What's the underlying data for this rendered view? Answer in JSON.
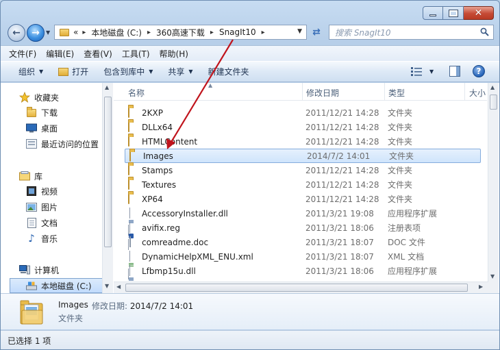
{
  "address": {
    "overflow": "«",
    "crumbs": [
      "本地磁盘 (C:)",
      "360高速下载",
      "SnagIt10"
    ]
  },
  "search": {
    "placeholder": "搜索 SnagIt10"
  },
  "menu": [
    "文件(F)",
    "编辑(E)",
    "查看(V)",
    "工具(T)",
    "帮助(H)"
  ],
  "commands": {
    "organize": "组织",
    "open": "打开",
    "include_library": "包含到库中",
    "share": "共享",
    "new_folder": "新建文件夹"
  },
  "nav": {
    "favorites": "收藏夹",
    "downloads": "下载",
    "desktop": "桌面",
    "recent": "最近访问的位置",
    "libraries": "库",
    "videos": "视频",
    "pictures": "图片",
    "documents": "文档",
    "music": "音乐",
    "computer": "计算机",
    "local_disk": "本地磁盘 (C:)"
  },
  "columns": {
    "name": "名称",
    "date": "修改日期",
    "type": "类型",
    "size": "大小"
  },
  "files": [
    {
      "name": "2KXP",
      "date": "2011/12/21 14:28",
      "type": "文件夹",
      "icon": "folder"
    },
    {
      "name": "DLLx64",
      "date": "2011/12/21 14:28",
      "type": "文件夹",
      "icon": "folder"
    },
    {
      "name": "HTMLContent",
      "date": "2011/12/21 14:28",
      "type": "文件夹",
      "icon": "folder"
    },
    {
      "name": "Images",
      "date": "2014/7/2 14:01",
      "type": "文件夹",
      "icon": "folder",
      "selected": true
    },
    {
      "name": "Stamps",
      "date": "2011/12/21 14:28",
      "type": "文件夹",
      "icon": "folder"
    },
    {
      "name": "Textures",
      "date": "2011/12/21 14:28",
      "type": "文件夹",
      "icon": "folder"
    },
    {
      "name": "XP64",
      "date": "2011/12/21 14:28",
      "type": "文件夹",
      "icon": "folder"
    },
    {
      "name": "AccessoryInstaller.dll",
      "date": "2011/3/21 19:08",
      "type": "应用程序扩展",
      "icon": "dll"
    },
    {
      "name": "avifix.reg",
      "date": "2011/3/21 18:06",
      "type": "注册表项",
      "icon": "reg"
    },
    {
      "name": "comreadme.doc",
      "date": "2011/3/21 18:07",
      "type": "DOC 文件",
      "icon": "doc"
    },
    {
      "name": "DynamicHelpXML_ENU.xml",
      "date": "2011/3/21 18:07",
      "type": "XML 文档",
      "icon": "xml"
    },
    {
      "name": "Lfbmp15u.dll",
      "date": "2011/3/21 18:06",
      "type": "应用程序扩展",
      "icon": "dll"
    }
  ],
  "details": {
    "name": "Images",
    "modified_label": "修改日期:",
    "modified_value": "2014/7/2 14:01",
    "type": "文件夹"
  },
  "status": "已选择 1 项",
  "colors": {
    "annotation_arrow": "#c0141c",
    "selection": "#cfe4fc"
  }
}
